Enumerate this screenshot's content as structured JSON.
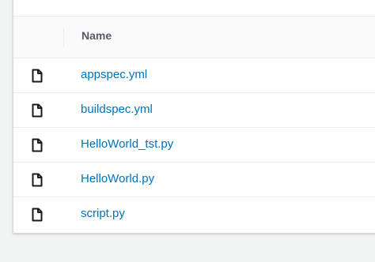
{
  "table": {
    "name_header": "Name",
    "files": [
      {
        "name": "appspec.yml",
        "icon": "file-icon"
      },
      {
        "name": "buildspec.yml",
        "icon": "file-icon"
      },
      {
        "name": "HelloWorld_tst.py",
        "icon": "file-icon"
      },
      {
        "name": "HelloWorld.py",
        "icon": "file-icon"
      },
      {
        "name": "script.py",
        "icon": "file-icon"
      }
    ]
  },
  "colors": {
    "link": "#0073bb",
    "header_text": "#545b64",
    "icon": "#16191f",
    "background": "#f2f3f3"
  }
}
